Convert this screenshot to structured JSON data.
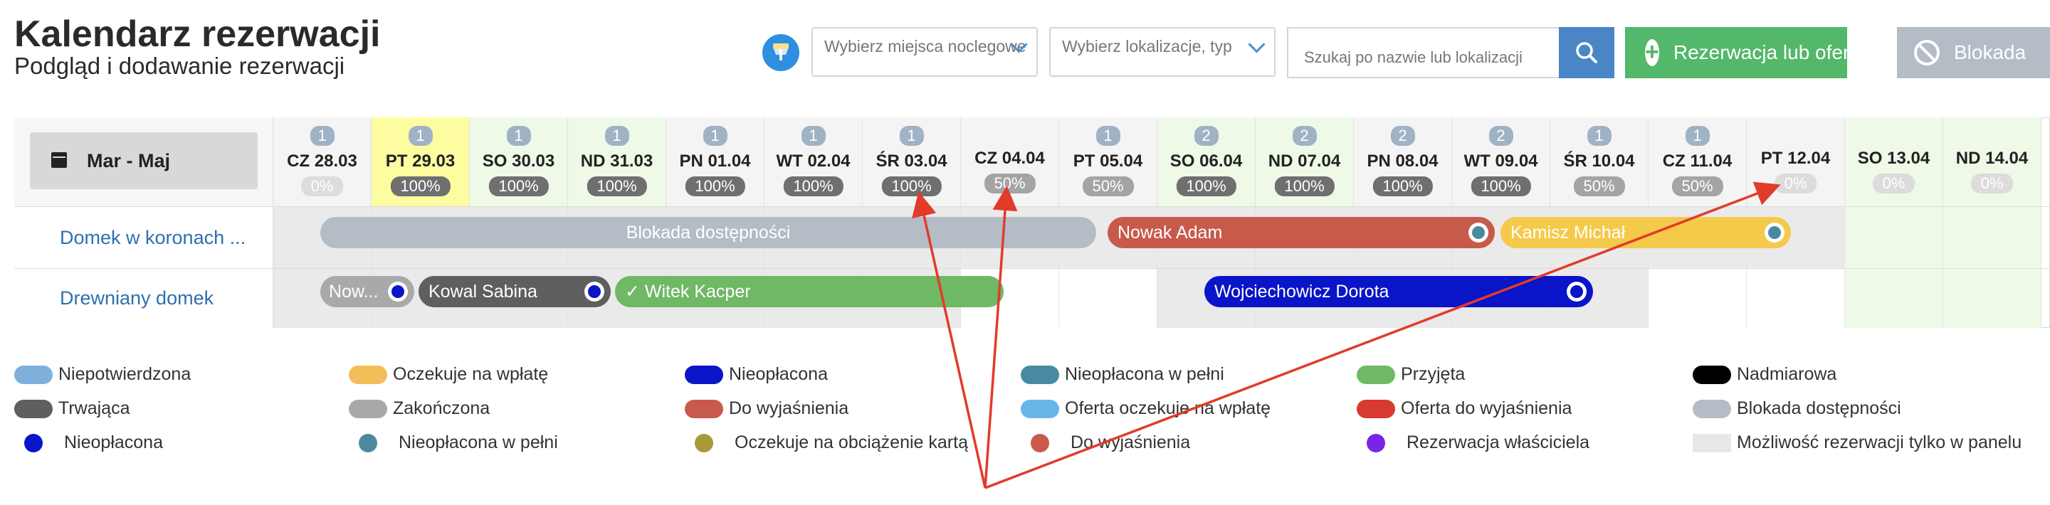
{
  "header": {
    "title": "Kalendarz rezerwacji",
    "subtitle": "Podgląd i dodawanie rezerwacji",
    "filter1_placeholder": "Wybierz miejsca noclegowe",
    "filter2_placeholder": "Wybierz lokalizacje, typ",
    "search_placeholder": "Szukaj po nazwie lub lokalizacji",
    "reservation_button": "Rezerwacja lub oferta",
    "block_button": "Blokada"
  },
  "calendar": {
    "range_label": "Mar - Maj",
    "days": [
      {
        "label": "CZ 28.03",
        "count": "1",
        "percent": "0%",
        "pct_kind": "zero",
        "bg": "#f4f4f4"
      },
      {
        "label": "PT 29.03",
        "count": "1",
        "percent": "100%",
        "pct_kind": "full",
        "bg": "#fdfca0"
      },
      {
        "label": "SO 30.03",
        "count": "1",
        "percent": "100%",
        "pct_kind": "full",
        "bg": "#eef9e8"
      },
      {
        "label": "ND 31.03",
        "count": "1",
        "percent": "100%",
        "pct_kind": "full",
        "bg": "#eef9e8"
      },
      {
        "label": "PN 01.04",
        "count": "1",
        "percent": "100%",
        "pct_kind": "full",
        "bg": "#f4f4f4"
      },
      {
        "label": "WT 02.04",
        "count": "1",
        "percent": "100%",
        "pct_kind": "full",
        "bg": "#f4f4f4"
      },
      {
        "label": "ŚR 03.04",
        "count": "1",
        "percent": "100%",
        "pct_kind": "full",
        "bg": "#f4f4f4"
      },
      {
        "label": "CZ 04.04",
        "count": "",
        "percent": "50%",
        "pct_kind": "half",
        "bg": "#f4f4f4"
      },
      {
        "label": "PT 05.04",
        "count": "1",
        "percent": "50%",
        "pct_kind": "half",
        "bg": "#f4f4f4"
      },
      {
        "label": "SO 06.04",
        "count": "2",
        "percent": "100%",
        "pct_kind": "full",
        "bg": "#eef9e8"
      },
      {
        "label": "ND 07.04",
        "count": "2",
        "percent": "100%",
        "pct_kind": "full",
        "bg": "#eef9e8"
      },
      {
        "label": "PN 08.04",
        "count": "2",
        "percent": "100%",
        "pct_kind": "full",
        "bg": "#f4f4f4"
      },
      {
        "label": "WT 09.04",
        "count": "2",
        "percent": "100%",
        "pct_kind": "full",
        "bg": "#f4f4f4"
      },
      {
        "label": "ŚR 10.04",
        "count": "1",
        "percent": "50%",
        "pct_kind": "half",
        "bg": "#f4f4f4"
      },
      {
        "label": "CZ 11.04",
        "count": "1",
        "percent": "50%",
        "pct_kind": "half",
        "bg": "#f4f4f4"
      },
      {
        "label": "PT 12.04",
        "count": "",
        "percent": "0%",
        "pct_kind": "zero",
        "bg": "#f4f4f4"
      },
      {
        "label": "SO 13.04",
        "count": "",
        "percent": "0%",
        "pct_kind": "zero",
        "bg": "#eef9e8"
      },
      {
        "label": "ND 14.04",
        "count": "",
        "percent": "0%",
        "pct_kind": "zero",
        "bg": "#eef9e8"
      }
    ],
    "rows": [
      {
        "name": "Domek w koronach ..."
      },
      {
        "name": "Drewniany domek"
      }
    ],
    "reservations": {
      "blokada": "Blokada dostępności",
      "nowak_adam": "Nowak Adam",
      "kamisz": "Kamisz Michał",
      "now": "Now...",
      "kowal": "Kowal Sabina",
      "witek": "Witek Kacper",
      "wojciechowicz": "Wojciechowicz Dorota"
    }
  },
  "legend": {
    "col1": [
      "Niepotwierdzona",
      "Trwająca",
      "Nieopłacona"
    ],
    "col2": [
      "Oczekuje na wpłatę",
      "Zakończona",
      "Nieopłacona w pełni"
    ],
    "col3": [
      "Nieopłacona",
      "Do wyjaśnienia",
      "Oczekuje na obciążenie kartą"
    ],
    "col4": [
      "Nieopłacona w pełni",
      "Oferta oczekuje na wpłatę",
      "Do wyjaśnienia"
    ],
    "col5": [
      "Przyjęta",
      "Oferta do wyjaśnienia",
      "Rezerwacja właściciela"
    ],
    "col6": [
      "Nadmiarowa",
      "Blokada dostępności",
      "Możliwość rezerwacji tylko w panelu"
    ]
  },
  "colors": {
    "niepotwierdzona": "#7fb0dc",
    "oczekuje": "#f2be5a",
    "nieoplacona": "#0a14c8",
    "nieoplacona_w_pelni": "#4a8aa0",
    "przyjeta": "#6fb864",
    "nadmiarowa": "#000000",
    "trwajaca": "#5f5f5f",
    "zakonczona": "#a9a9a9",
    "do_wyjasnienia": "#c85a4c",
    "oferta_oczekuje": "#66b6ea",
    "oferta_do_wyjasnienia": "#d63a30",
    "blokada": "#b4bcc6",
    "oczekuje_karta": "#a89a3a",
    "wlasciciel": "#7a24e8",
    "tylko_panel": "#e8e8e8",
    "annotation": "#e23b2a"
  }
}
